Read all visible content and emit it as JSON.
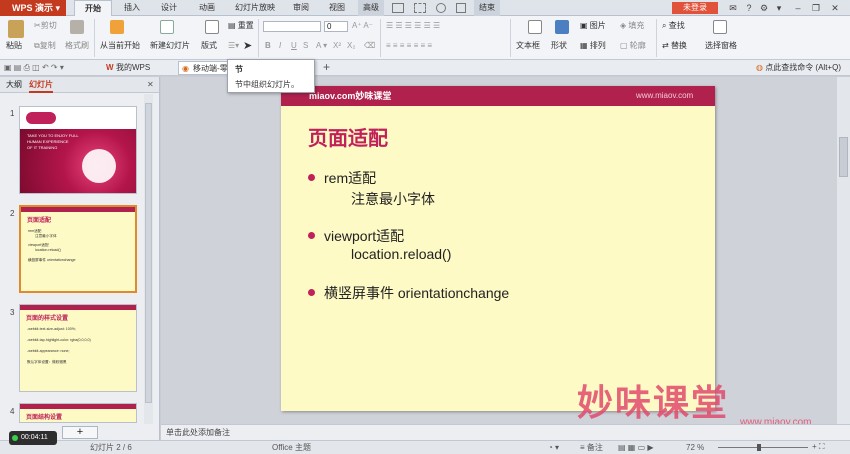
{
  "app": {
    "name": "WPS 演示",
    "login": "未登录"
  },
  "menu": {
    "tabs": [
      "开始",
      "插入",
      "设计",
      "动画",
      "幻灯片放映",
      "审阅",
      "视图",
      "高级",
      "",
      "",
      "",
      "",
      "",
      "",
      "结束"
    ]
  },
  "ribbon": {
    "paste": "粘贴",
    "cut": "剪切",
    "copy": "复制",
    "format_painter": "格式刷",
    "from_current": "从当前开始",
    "new_slide": "新建幻灯片",
    "layout": "版式",
    "reset": "重置",
    "section": "节",
    "font_size": "0",
    "text_box": "文本框",
    "shape": "形状",
    "picture": "图片",
    "fill": "填充",
    "arrange": "排列",
    "outline": "轮廓",
    "find": "查找",
    "replace": "替换",
    "select_pane": "选择窗格"
  },
  "tabbar": {
    "my_wps": "我的WPS",
    "doc_tab": "移动端-零",
    "search": "点此查找命令 (Alt+Q)"
  },
  "tooltip": {
    "title": "节",
    "desc": "节中组织幻灯片。"
  },
  "panel": {
    "outline_tab": "大纲",
    "slides_tab": "幻灯片",
    "thumbs": [
      {
        "num": "1",
        "text": [
          "TAKE YOU TO ENJOY FULL",
          "HUMAN EXPERIENCE",
          "OF IT TRAINING"
        ]
      },
      {
        "num": "2",
        "title": "页面适配",
        "lines": [
          "rem适配",
          "注意最小字体",
          "viewport适配",
          "location.reload()",
          "横竖屏事件 orientationchange"
        ]
      },
      {
        "num": "3",
        "title": "页面的样式设置",
        "lines": [
          "-webkit-text-size-adjust: 100%;",
          "-webkit-tap-highlight-color: rgba(0,0,0,0)",
          "-webkit-appearance: none;",
          "默认字体设置：微软雅黑"
        ]
      },
      {
        "num": "4",
        "title": "页面结构设置"
      }
    ]
  },
  "slide": {
    "brand": "miaov.com妙味课堂",
    "url": "www.miaov.com",
    "title": "页面适配",
    "bullets": [
      {
        "text": "rem适配",
        "sub": "注意最小字体"
      },
      {
        "text": "viewport适配",
        "sub": "location.reload()"
      },
      {
        "text": "横竖屏事件 orientationchange",
        "sub": ""
      }
    ]
  },
  "notes": {
    "placeholder": "单击此处添加备注"
  },
  "status": {
    "slide_counter": "幻灯片 2 / 6",
    "theme": "Office 主题",
    "notes_btn": "备注",
    "zoom": "72 %",
    "timer": "00:04:11"
  },
  "watermark": {
    "text": "妙味课堂",
    "url": "www.miaov.com"
  },
  "colors": {
    "accent": "#c0215a",
    "app_red": "#c43a1e",
    "slide_bg": "#fdfac5"
  }
}
